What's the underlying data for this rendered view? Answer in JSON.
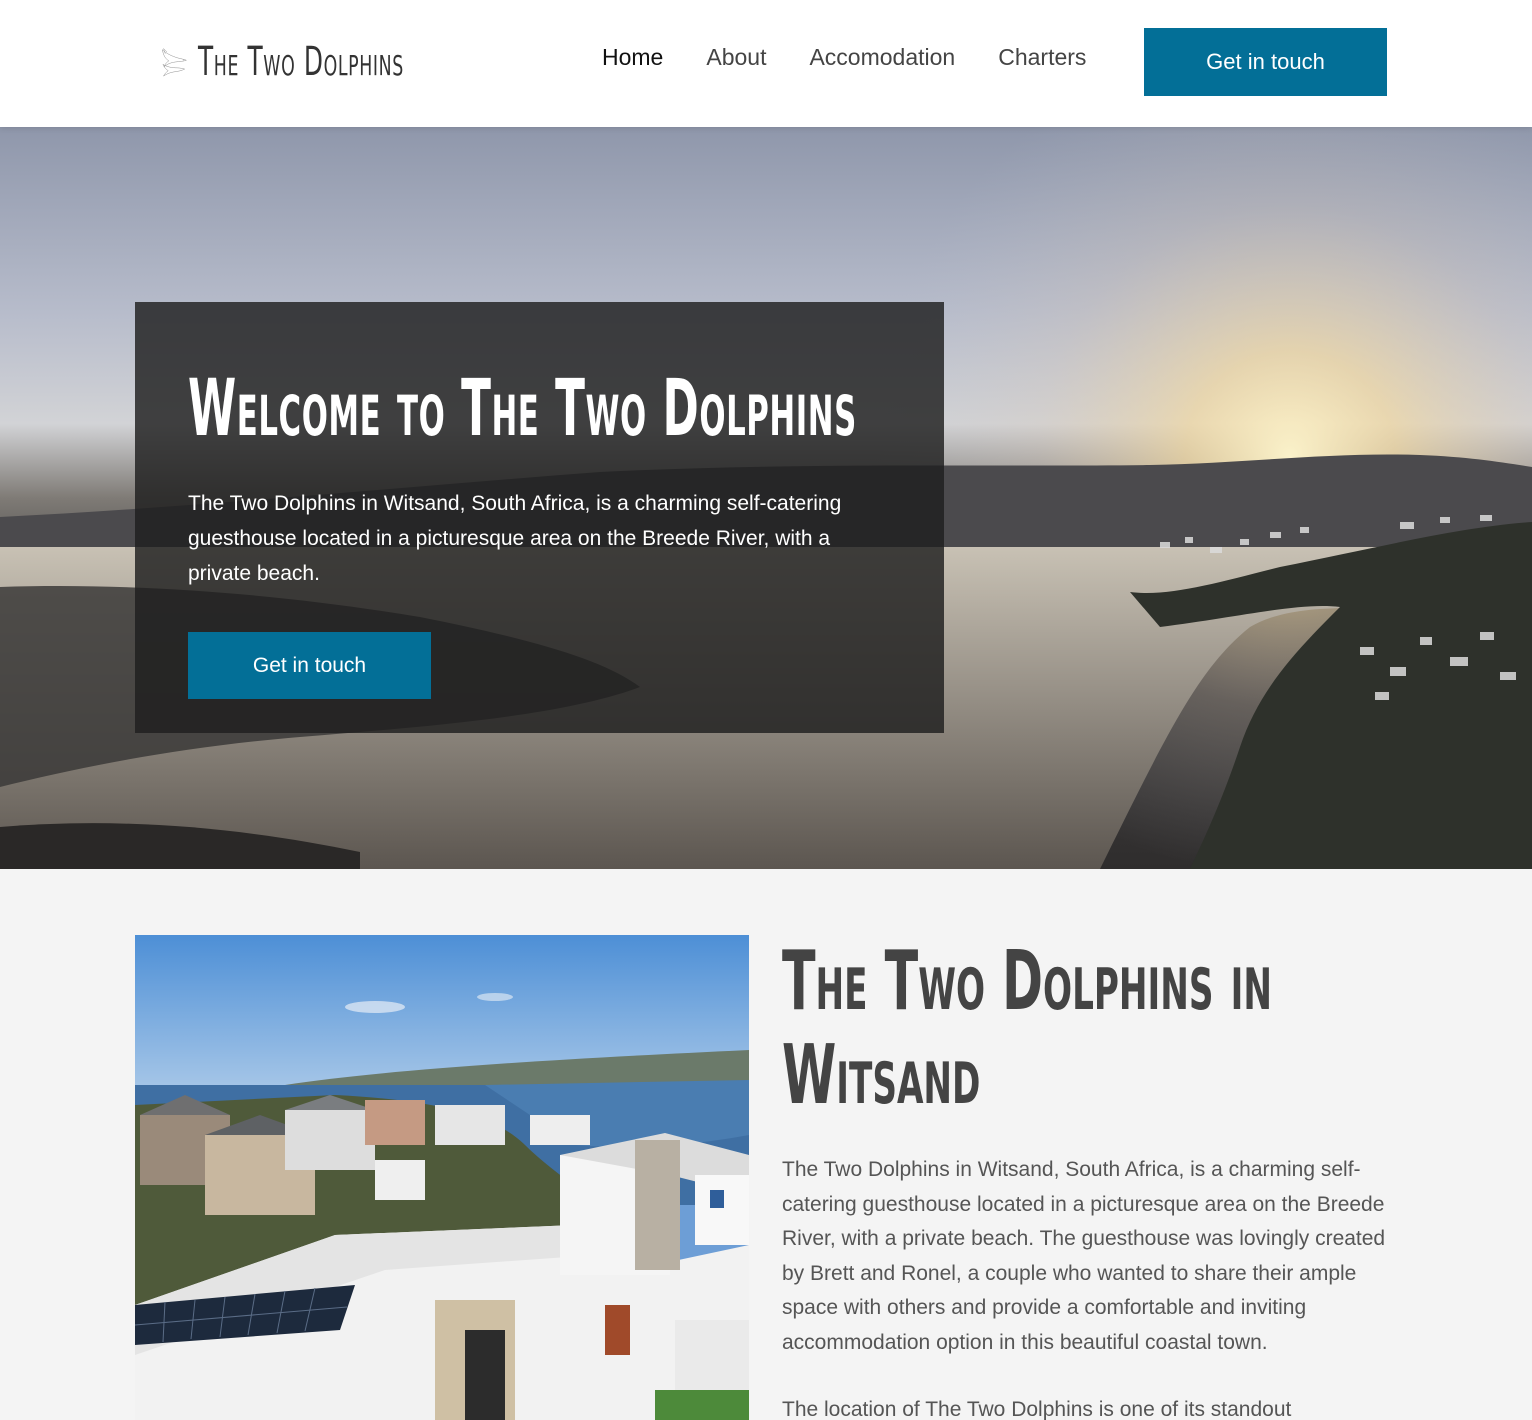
{
  "header": {
    "logo_text": "The Two Dolphins",
    "nav": [
      {
        "label": "Home",
        "active": true
      },
      {
        "label": "About",
        "active": false
      },
      {
        "label": "Accomodation",
        "active": false
      },
      {
        "label": "Charters",
        "active": false
      }
    ],
    "cta_label": "Get in touch"
  },
  "hero": {
    "title": "Welcome to The Two Dolphins",
    "text": "The Two Dolphins in Witsand, South Africa, is a charming self-catering guesthouse located in a picturesque area on the Breede River, with a private beach.",
    "cta_label": "Get in touch"
  },
  "about": {
    "title_line1": "The Two Dolphins in",
    "title_line2": "Witsand",
    "paragraph1": "The Two Dolphins in Witsand, South Africa, is a charming self-catering guesthouse located in a picturesque area on the Breede River, with a private beach. The guesthouse was lovingly created by Brett and Ronel, a couple who wanted to share their ample space with others and provide a comfortable and inviting accommodation option in this beautiful coastal town.",
    "paragraph2": "The location of The Two Dolphins is one of its standout"
  },
  "colors": {
    "accent": "#036f97",
    "page_background": "#f4f4f4",
    "header_background": "#ffffff"
  }
}
